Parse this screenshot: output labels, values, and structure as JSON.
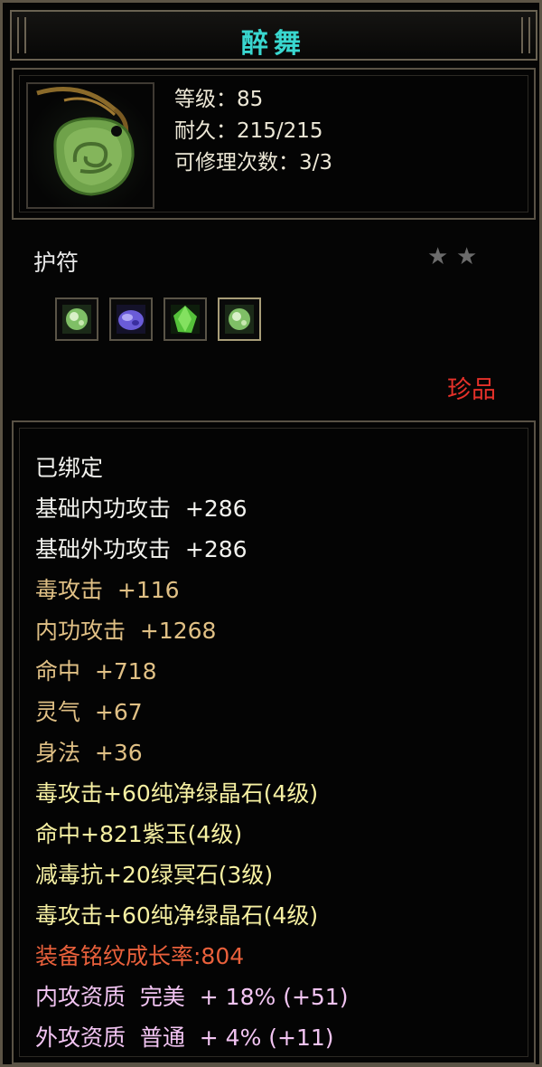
{
  "item": {
    "name": "醉舞",
    "level_line": "等级：85",
    "durability_line": "耐久：215/215",
    "repair_line": "可修理次数：3/3",
    "type": "护符",
    "stars": 2,
    "rarity": "珍品"
  },
  "gems": [
    {
      "name": "green-jade-gem-icon",
      "color": "#7fbf66"
    },
    {
      "name": "purple-gem-icon",
      "color": "#6a5cd8"
    },
    {
      "name": "green-crystal-gem-icon",
      "color": "#55c23a"
    },
    {
      "name": "green-jade-gem-icon",
      "color": "#7fbf66"
    }
  ],
  "attributes": [
    {
      "text": "已绑定",
      "color": "white"
    },
    {
      "text": "基础内功攻击  +286",
      "color": "white"
    },
    {
      "text": "基础外功攻击  +286",
      "color": "white"
    },
    {
      "text": "毒攻击  +116",
      "color": "gold"
    },
    {
      "text": "内功攻击  +1268",
      "color": "gold"
    },
    {
      "text": "命中  +718",
      "color": "gold"
    },
    {
      "text": "灵气  +67",
      "color": "gold"
    },
    {
      "text": "身法  +36",
      "color": "gold"
    },
    {
      "text": "毒攻击+60纯净绿晶石(4级)",
      "color": "yellow"
    },
    {
      "text": "命中+821紫玉(4级)",
      "color": "yellow"
    },
    {
      "text": "减毒抗+20绿冥石(3级)",
      "color": "yellow"
    },
    {
      "text": "毒攻击+60纯净绿晶石(4级)",
      "color": "yellow"
    },
    {
      "text": "装备铭纹成长率:804",
      "color": "orange"
    },
    {
      "text": "内攻资质  完美  + 18% (+51)",
      "color": "pink"
    },
    {
      "text": "外攻资质  普通  + 4% (+11)",
      "color": "pink"
    }
  ],
  "colors": {
    "title": "#39d7cf",
    "rarity": "#e5312a",
    "white": "#f2f2ee",
    "gold": "#e0c085",
    "yellow": "#f6f0a2",
    "orange": "#e9603b",
    "pink": "#f2c4f2"
  }
}
